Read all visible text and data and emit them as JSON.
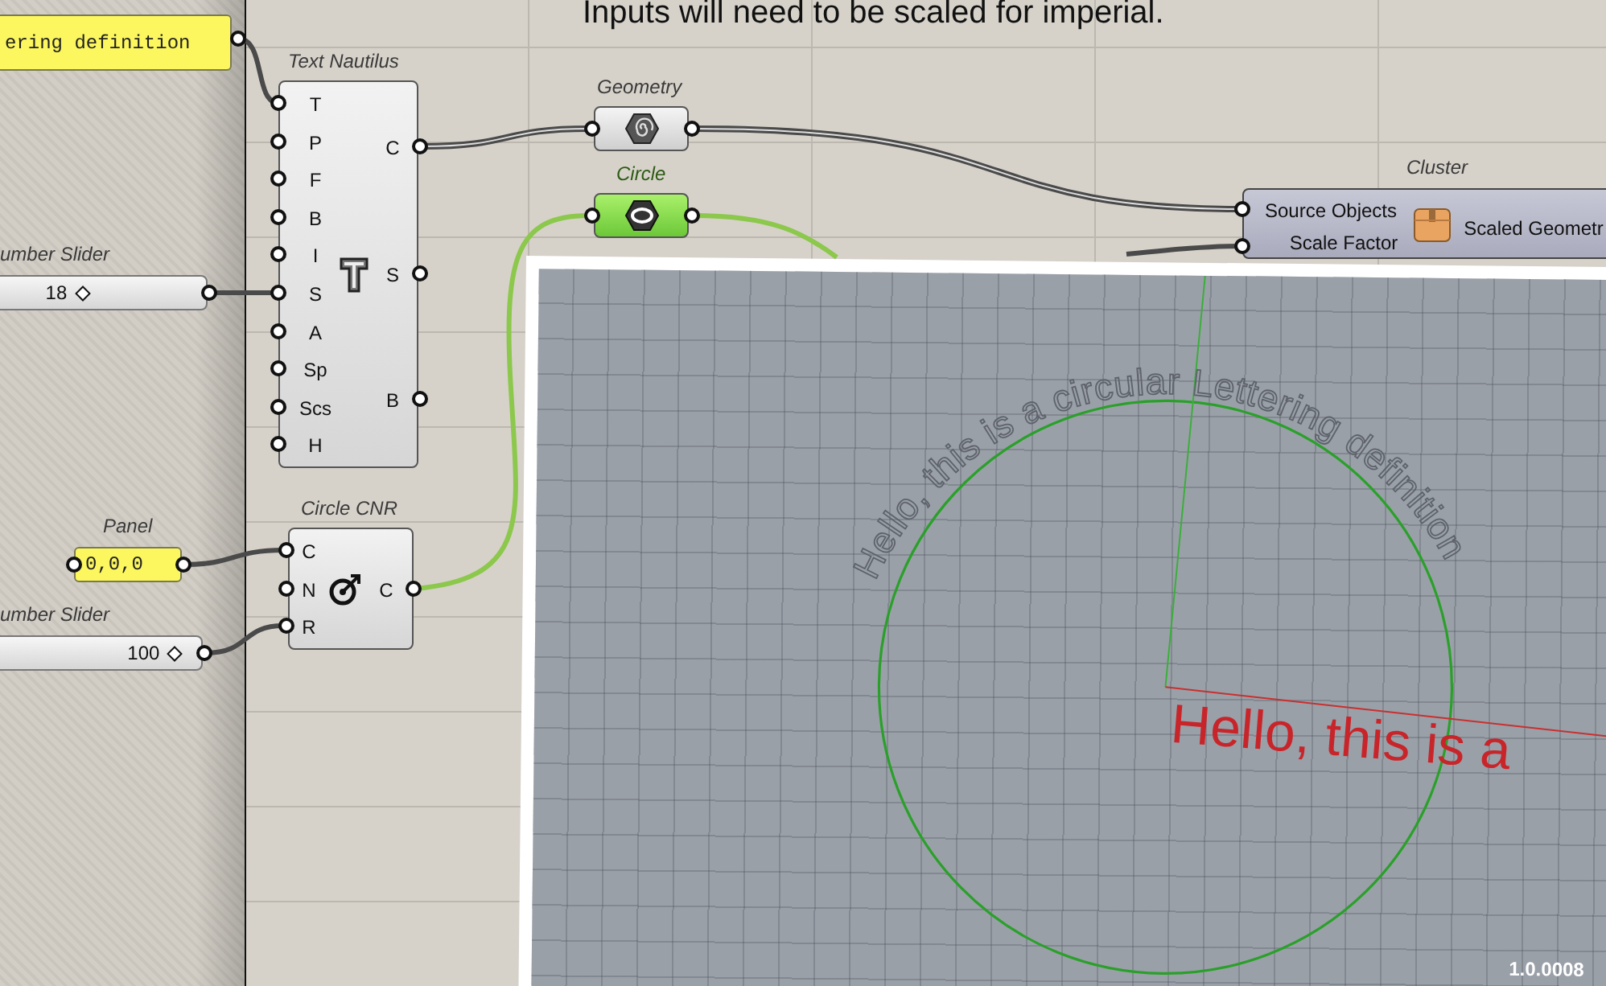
{
  "canvas_note": "Inputs will need to be scaled for imperial.",
  "text_panel": {
    "value": "ering definition"
  },
  "text_nautilus": {
    "title": "Text Nautilus",
    "inputs": [
      "T",
      "P",
      "F",
      "B",
      "I",
      "S",
      "A",
      "Sp",
      "Scs",
      "H"
    ],
    "outputs": [
      "C",
      "S",
      "B"
    ]
  },
  "slider_1": {
    "title": "umber Slider",
    "value": "18",
    "level": 0.44
  },
  "geometry": {
    "title": "Geometry",
    "selected": false
  },
  "circle": {
    "title": "Circle",
    "selected": true
  },
  "cluster": {
    "title": "Cluster",
    "inputs": [
      "Source Objects",
      "Scale Factor"
    ],
    "output": "Scaled Geometr"
  },
  "panel": {
    "title": "Panel",
    "value": "0,0,0"
  },
  "slider_2": {
    "title": "umber Slider",
    "value": "100",
    "level": 0.9
  },
  "circle_cnr": {
    "title": "Circle CNR",
    "inputs": [
      "C",
      "N",
      "R"
    ],
    "outputs": [
      "C"
    ]
  },
  "viewport": {
    "arc_text": "Hello, this is a circular Lettering definition",
    "flat_text": "Hello, this is a",
    "version": "1.0.0008"
  }
}
